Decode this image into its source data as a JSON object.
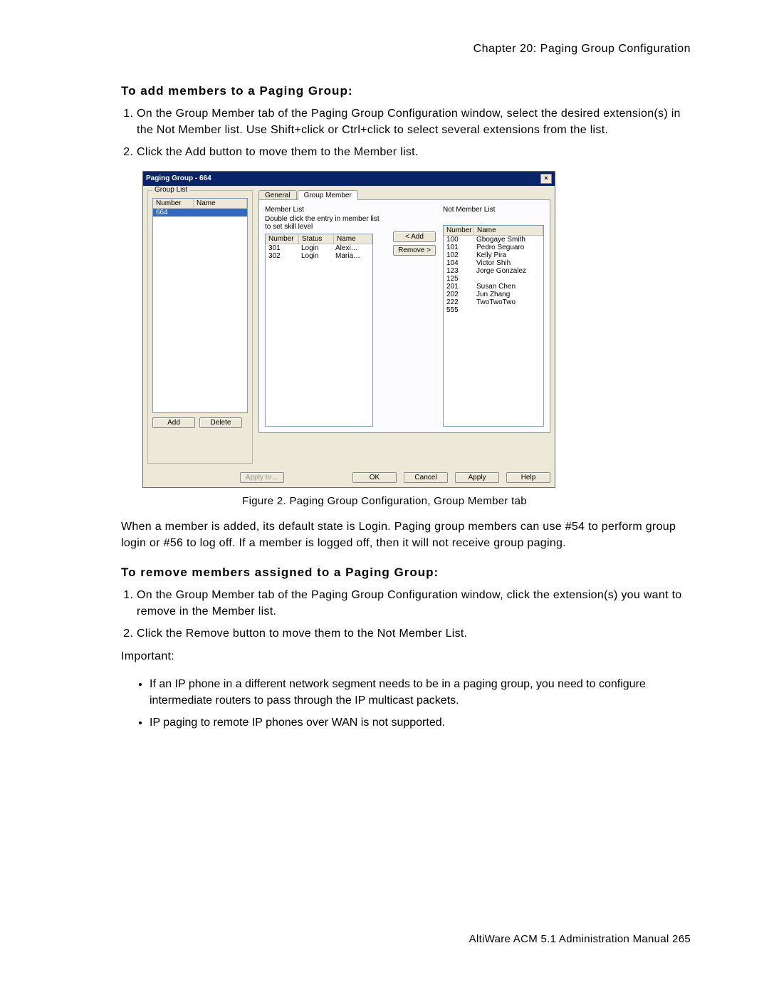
{
  "header": "Chapter 20:  Paging Group Configuration",
  "h_add": "To add members to a Paging Group:",
  "add_steps": [
    "On the Group Member tab of the Paging Group Configuration window, select the desired extension(s) in the Not Member list. Use Shift+click or Ctrl+click to select several extensions from the list.",
    "Click the Add button to move them to the Member list."
  ],
  "figcap": "Figure 2.   Paging Group Configuration, Group Member tab",
  "para_mid": "When a member is added, its default state is Login. Paging group members can use #54 to perform group login or #56 to log off. If a member is logged off, then it will not receive group paging.",
  "h_rem": "To remove members assigned to a Paging Group:",
  "rem_steps": [
    "On the Group Member tab of the Paging Group Configuration window, click the extension(s) you want to remove in the Member list.",
    "Click the Remove button to move them to the Not Member List."
  ],
  "important": "Important:",
  "notes": [
    "If an IP phone in a different network segment needs to be in a paging group, you need to configure intermediate routers to pass through the IP multicast packets.",
    "IP paging to remote IP phones over WAN is not supported."
  ],
  "footer": "AltiWare ACM 5.1 Administration Manual   265",
  "dlg": {
    "title": "Paging Group - 664",
    "group_list": {
      "legend": "Group List",
      "cols": [
        "Number",
        "Name"
      ],
      "rows": [
        [
          "664",
          ""
        ]
      ],
      "btn_add": "Add",
      "btn_del": "Delete"
    },
    "tabs": {
      "general": "General",
      "member": "Group Member"
    },
    "member_list": {
      "label": "Member List",
      "hint": "Double click the entry in member list to set skill level",
      "cols": [
        "Number",
        "Status",
        "Name"
      ],
      "rows": [
        [
          "301",
          "Login",
          "Alexi…"
        ],
        [
          "302",
          "Login",
          "Maria…"
        ]
      ]
    },
    "btn_add": "< Add",
    "btn_remove": "Remove >",
    "not_member": {
      "label": "Not Member List",
      "cols": [
        "Number",
        "Name"
      ],
      "rows": [
        [
          "100",
          "Gbogaye Smith"
        ],
        [
          "101",
          "Pedro Seguaro"
        ],
        [
          "102",
          "Kelly Pira"
        ],
        [
          "104",
          "Victor Shih"
        ],
        [
          "123",
          "Jorge Gonzalez"
        ],
        [
          "125",
          ""
        ],
        [
          "201",
          "Susan Chen"
        ],
        [
          "202",
          "Jun Zhang"
        ],
        [
          "222",
          "TwoTwoTwo"
        ],
        [
          "555",
          ""
        ]
      ]
    },
    "footer_btns": {
      "applyto": "Apply to…",
      "ok": "OK",
      "cancel": "Cancel",
      "apply": "Apply",
      "help": "Help"
    }
  }
}
